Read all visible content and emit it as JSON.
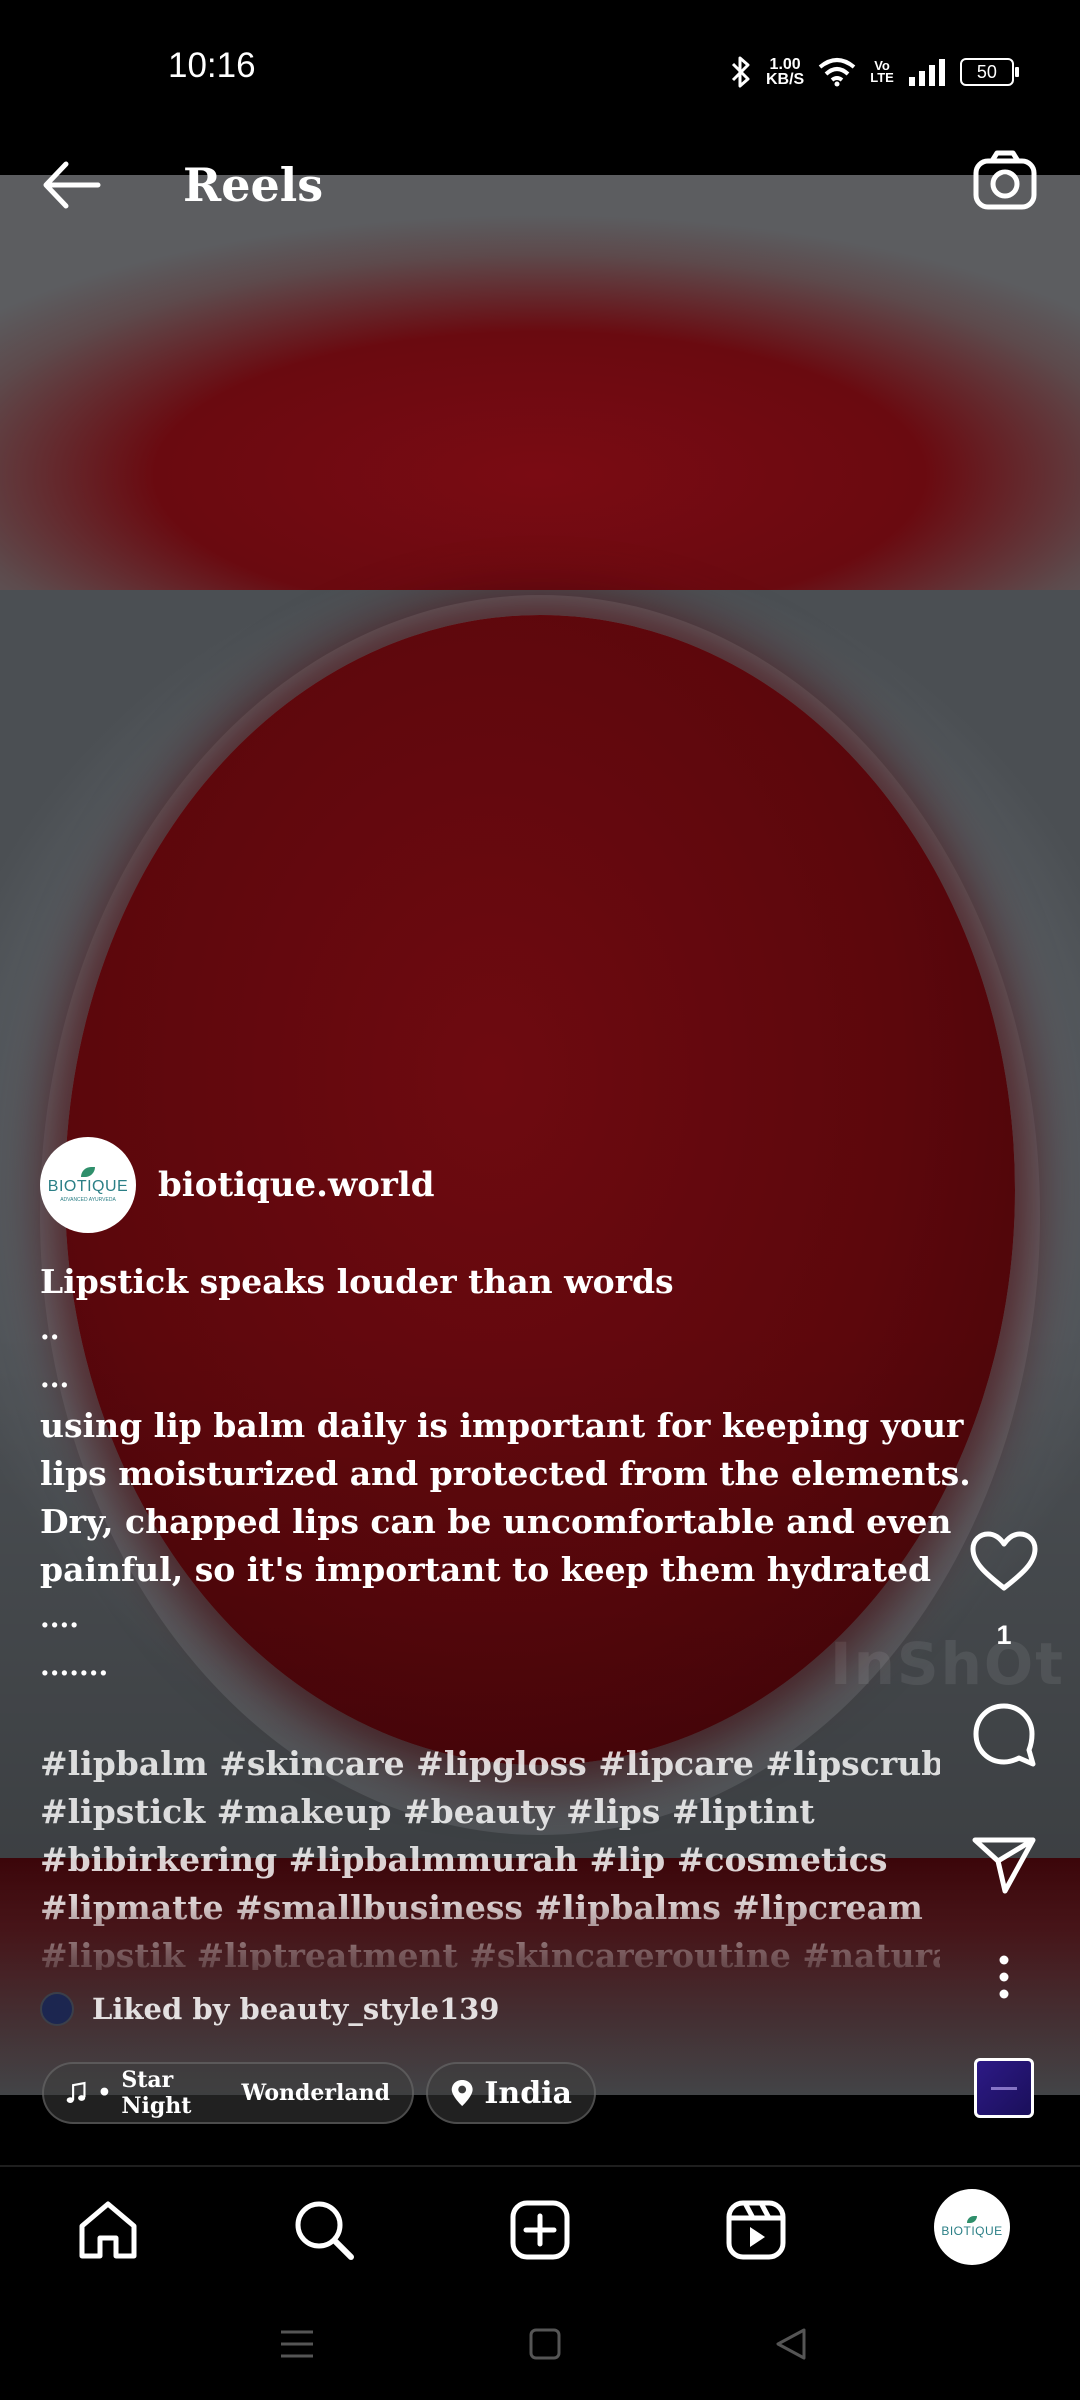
{
  "status_bar": {
    "time": "10:16",
    "net_speed_value": "1.00",
    "net_speed_unit": "KB/S",
    "volte_top": "Vo",
    "volte_bottom": "LTE",
    "battery": "50"
  },
  "header": {
    "title": "Reels"
  },
  "post": {
    "username": "biotique.world",
    "avatar_brand": "BIOTIQUE",
    "avatar_sub": "ADVANCED AYURVEDA",
    "caption_lines": [
      "Lipstick speaks louder than words",
      "..",
      "...",
      "using lip balm daily is important for keeping your",
      "lips moisturized and protected from the elements.",
      "Dry, chapped lips can be uncomfortable and even",
      "painful, so it's important to keep them hydrated",
      "....",
      "......."
    ],
    "hashtag_lines": [
      "#lipbalm #skincare #lipgloss #lipcare #lipscrub",
      "#lipstick #makeup #beauty #lips #liptint",
      "#bibirkering #lipbalmmurah #lip #cosmetics",
      "#lipmatte #smallbusiness #lipbalms #lipcream",
      "#lipstik #liptreatment #skincareroutine #natural"
    ],
    "liked_by": "Liked by beauty_style139",
    "audio_artist": "Star Night",
    "audio_title": "Wonderland",
    "location": "India",
    "like_count": "1",
    "watermark": "InShOt"
  },
  "icons": {
    "back": "back-arrow-icon",
    "camera": "camera-icon",
    "like": "heart-icon",
    "comment": "comment-icon",
    "share": "send-icon",
    "more": "more-vertical-icon",
    "music": "music-note-icon",
    "location": "location-pin-icon",
    "home": "home-icon",
    "search": "search-icon",
    "create": "add-square-icon",
    "reels": "reels-icon",
    "recents": "menu-lines-icon",
    "system_home": "square-icon",
    "system_back": "triangle-back-icon"
  },
  "colors": {
    "background": "#000000",
    "balm_red": "#5c070c",
    "plate_gray": "#5a5e63",
    "text": "#ffffff"
  }
}
